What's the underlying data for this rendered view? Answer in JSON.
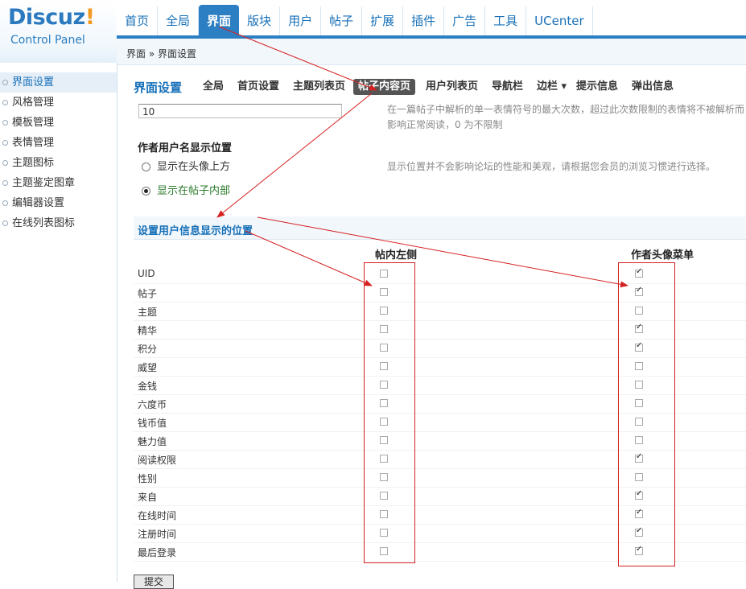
{
  "logo": {
    "brand": "Discuz",
    "bang": "!",
    "sub": "Control Panel"
  },
  "topnav": [
    "首页",
    "全局",
    "界面",
    "版块",
    "用户",
    "帖子",
    "扩展",
    "插件",
    "广告",
    "工具",
    "UCenter"
  ],
  "breadcrumb": "界面 » 界面设置",
  "sidebar": [
    "界面设置",
    "风格管理",
    "模板管理",
    "表情管理",
    "主题图标",
    "主题鉴定图章",
    "编辑器设置",
    "在线列表图标"
  ],
  "subtabs": {
    "title": "界面设置",
    "items": [
      "全局",
      "首页设置",
      "主题列表页",
      "帖子内容页",
      "用户列表页",
      "导航栏",
      "边栏 ▾",
      "提示信息",
      "弹出信息"
    ]
  },
  "smiley_section": {
    "value": "10",
    "tip_line1": "在一篇帖子中解析的单一表情符号的最大次数，超过此次数限制的表情将不被解析而",
    "tip_line2": "影响正常阅读，0 为不限制"
  },
  "author_position": {
    "label": "作者用户名显示位置",
    "option1": "显示在头像上方",
    "option2": "显示在帖子内部",
    "tip": "显示位置并不会影响论坛的性能和美观，请根据您会员的浏览习惯进行选择。"
  },
  "userinfo": {
    "section_title": "设置用户信息显示的位置",
    "col_left": "帖内左侧",
    "col_right": "作者头像菜单",
    "rows": [
      {
        "name": "UID",
        "left": false,
        "right": true
      },
      {
        "name": "帖子",
        "left": false,
        "right": true
      },
      {
        "name": "主题",
        "left": false,
        "right": false
      },
      {
        "name": "精华",
        "left": false,
        "right": true
      },
      {
        "name": "积分",
        "left": false,
        "right": true
      },
      {
        "name": "威望",
        "left": false,
        "right": false
      },
      {
        "name": "金钱",
        "left": false,
        "right": false
      },
      {
        "name": "六度币",
        "left": false,
        "right": false
      },
      {
        "name": "钱币值",
        "left": false,
        "right": false
      },
      {
        "name": "魅力值",
        "left": false,
        "right": false
      },
      {
        "name": "阅读权限",
        "left": false,
        "right": true
      },
      {
        "name": "性别",
        "left": false,
        "right": false
      },
      {
        "name": "来自",
        "left": false,
        "right": true
      },
      {
        "name": "在线时间",
        "left": false,
        "right": true
      },
      {
        "name": "注册时间",
        "left": false,
        "right": true
      },
      {
        "name": "最后登录",
        "left": false,
        "right": true
      }
    ]
  },
  "submit_label": "提交",
  "colors": {
    "accent": "#2d7fc4",
    "annotation": "#d62020"
  }
}
